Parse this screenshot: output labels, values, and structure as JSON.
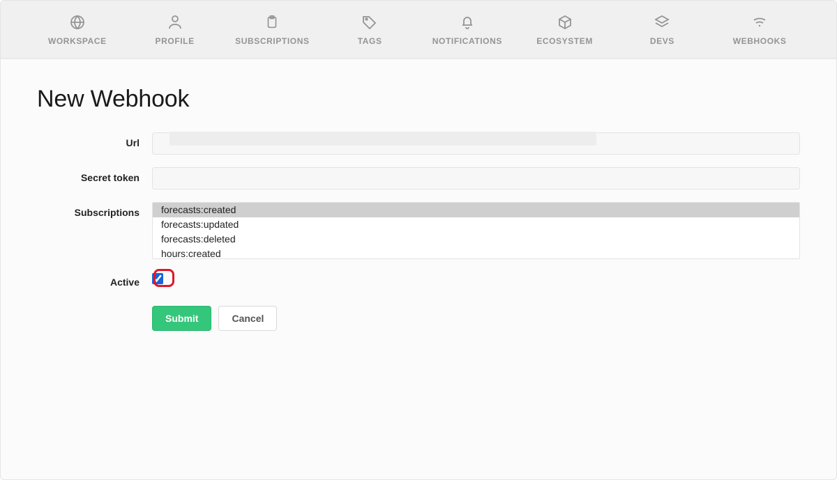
{
  "nav": {
    "items": [
      {
        "label": "WORKSPACE",
        "icon": "globe-icon"
      },
      {
        "label": "PROFILE",
        "icon": "user-icon"
      },
      {
        "label": "SUBSCRIPTIONS",
        "icon": "clipboard-icon"
      },
      {
        "label": "TAGS",
        "icon": "tag-icon"
      },
      {
        "label": "NOTIFICATIONS",
        "icon": "bell-icon"
      },
      {
        "label": "ECOSYSTEM",
        "icon": "cube-icon"
      },
      {
        "label": "DEVS",
        "icon": "layers-icon"
      },
      {
        "label": "WEBHOOKS",
        "icon": "wifi-icon"
      }
    ]
  },
  "page": {
    "title": "New Webhook"
  },
  "form": {
    "url": {
      "label": "Url",
      "value": ""
    },
    "secret_token": {
      "label": "Secret token",
      "value": ""
    },
    "subscriptions": {
      "label": "Subscriptions",
      "options": [
        {
          "value": "forecasts:created",
          "selected": true
        },
        {
          "value": "forecasts:updated",
          "selected": false
        },
        {
          "value": "forecasts:deleted",
          "selected": false
        },
        {
          "value": "hours:created",
          "selected": false
        }
      ]
    },
    "active": {
      "label": "Active",
      "checked": true
    },
    "buttons": {
      "submit": "Submit",
      "cancel": "Cancel"
    }
  },
  "colors": {
    "nav_bg": "#f0f0f0",
    "nav_fg": "#949494",
    "primary_btn": "#34c77b",
    "checkbox_accent": "#1b63d6",
    "highlight_ring": "#e0162b"
  }
}
